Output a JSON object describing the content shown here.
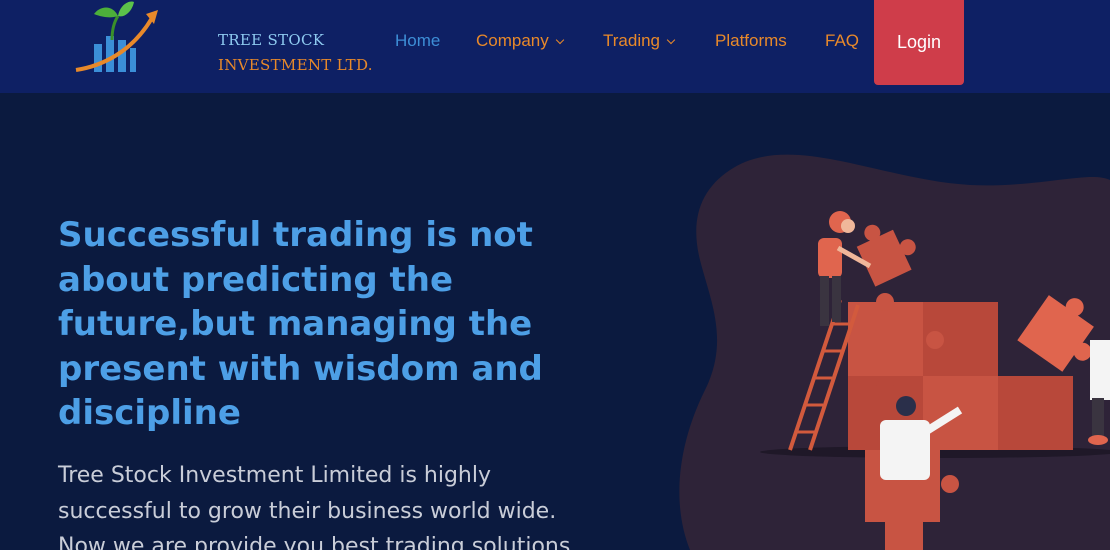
{
  "brand": {
    "line1": "TREE STOCK",
    "line2": "INVESTMENT LTD."
  },
  "nav": {
    "home": "Home",
    "company": "Company",
    "trading": "Trading",
    "platforms": "Platforms",
    "faq": "FAQ",
    "login": "Login"
  },
  "hero": {
    "title": "Successful trading is not about predicting the future,but managing the present with wisdom and discipline",
    "text": "Tree Stock Investment Limited is highly successful to grow their business world wide. Now we are provide you best trading solutions"
  },
  "colors": {
    "navbar": "#0e2064",
    "background": "#0b1a3f",
    "accent": "#e8892a",
    "title": "#4d9fe6",
    "login": "#cf3d4a"
  }
}
